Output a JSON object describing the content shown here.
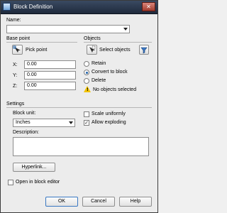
{
  "window": {
    "title": "Block Definition",
    "close_glyph": "✕"
  },
  "name": {
    "label": "Name:",
    "value": ""
  },
  "base_point": {
    "title": "Base point",
    "pick_label": "Pick point",
    "x_label": "X:",
    "x_value": "0.00",
    "y_label": "Y:",
    "y_value": "0.00",
    "z_label": "Z:",
    "z_value": "0.00"
  },
  "objects": {
    "title": "Objects",
    "select_label": "Select objects",
    "retain_label": "Retain",
    "convert_label": "Convert to block",
    "delete_label": "Delete",
    "selected_option": "Convert to block",
    "status": "No objects selected"
  },
  "settings": {
    "title": "Settings",
    "unit_label": "Block unit:",
    "unit_value": "Inches",
    "scale_label": "Scale uniformly",
    "scale_checked": false,
    "explode_label": "Allow exploding",
    "explode_checked": true
  },
  "description": {
    "label": "Description:",
    "value": ""
  },
  "hyperlink_label": "Hyperlink...",
  "open_in_editor": {
    "label": "Open in block editor",
    "checked": false
  },
  "buttons": {
    "ok": "OK",
    "cancel": "Cancel",
    "help": "Help"
  },
  "colors": {
    "titlebar": "#2b3a52",
    "accent": "#1c5fa8",
    "warning": "#f2c300"
  }
}
